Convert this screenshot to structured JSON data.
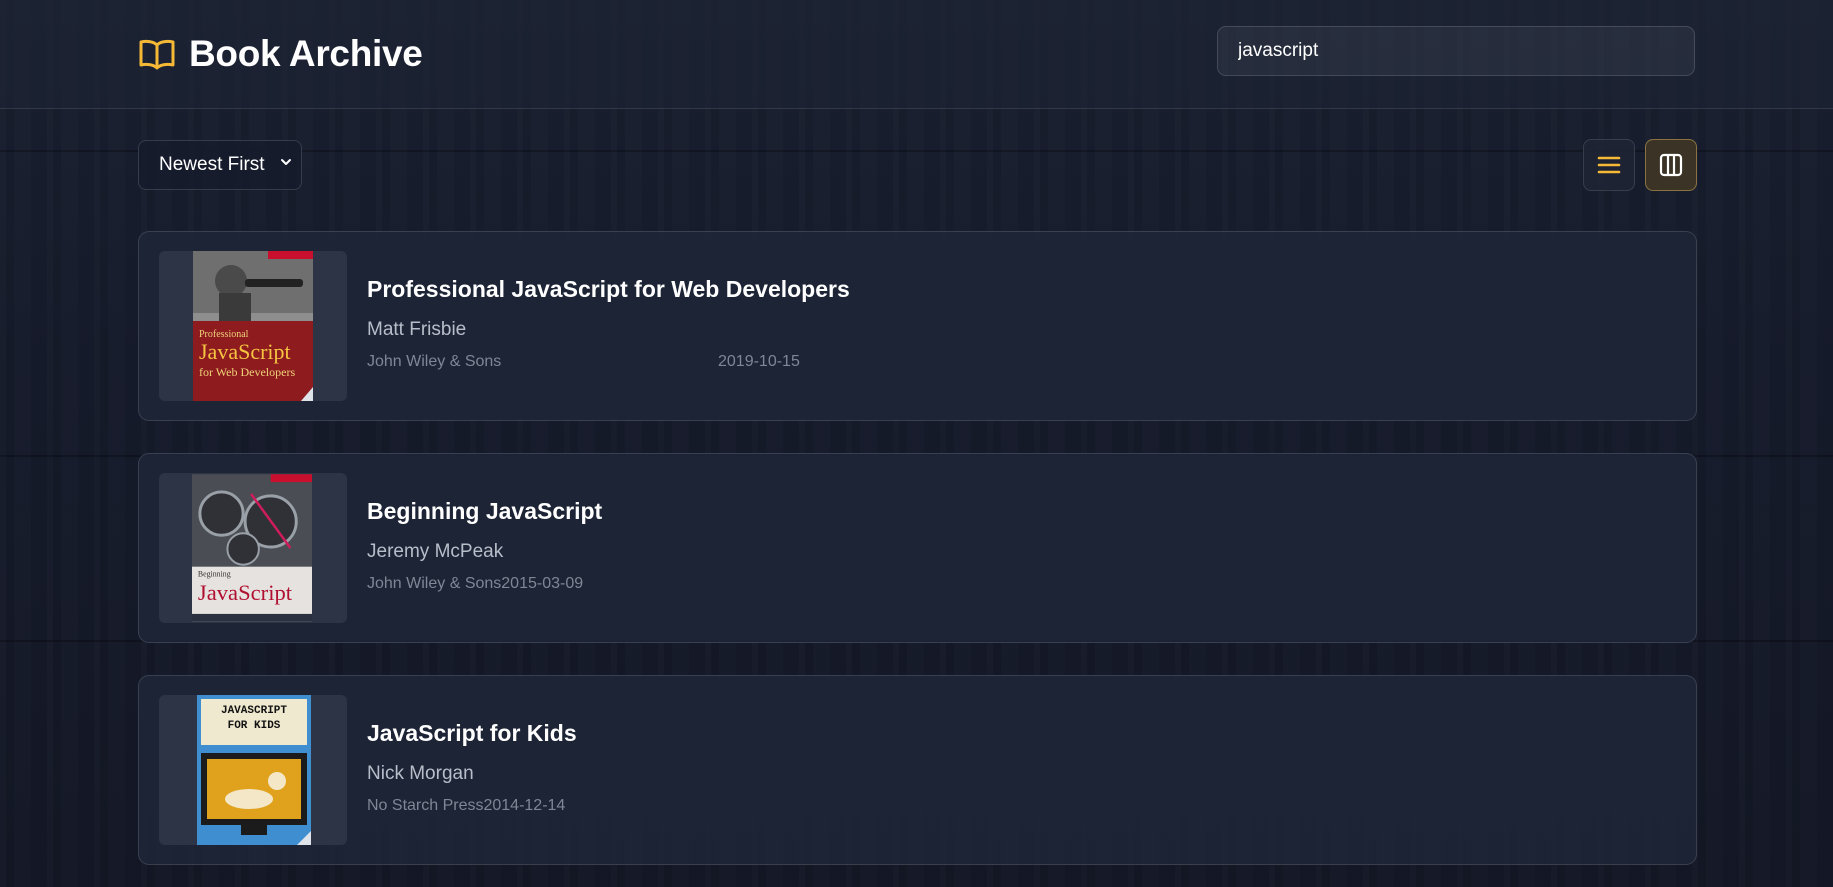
{
  "header": {
    "title": "Book Archive",
    "icon": "open-book-icon",
    "accent_color": "#f5b936"
  },
  "search": {
    "value": "javascript"
  },
  "toolbar": {
    "sort_label": "Newest First",
    "list_view_icon": "list-view-icon",
    "grid_view_icon": "grid-view-icon",
    "active_view": "grid"
  },
  "books": [
    {
      "title": "Professional JavaScript for Web Developers",
      "author": "Matt Frisbie",
      "publisher": "John Wiley & Sons",
      "date": "2019-10-15",
      "cover_text": [
        "Professional",
        "JavaScript",
        "for Web Developers"
      ]
    },
    {
      "title": "Beginning JavaScript",
      "author": "Jeremy McPeak",
      "publisher": "John Wiley & Sons",
      "date": "2015-03-09",
      "cover_text": [
        "Beginning",
        "JavaScript"
      ]
    },
    {
      "title": "JavaScript for Kids",
      "author": "Nick Morgan",
      "publisher": "No Starch Press",
      "date": "2014-12-14",
      "cover_text": [
        "JAVASCRIPT",
        "FOR KIDS"
      ]
    }
  ]
}
